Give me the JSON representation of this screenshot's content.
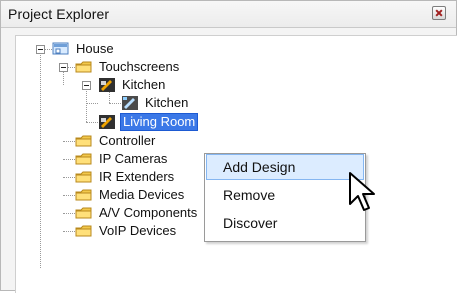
{
  "panel": {
    "title": "Project Explorer"
  },
  "tree": {
    "root": "House",
    "touchscreens": "Touchscreens",
    "kitchen_group": "Kitchen",
    "kitchen_device": "Kitchen",
    "living_room": "Living Room",
    "controller": "Controller",
    "ip_cameras": "IP Cameras",
    "ir_extenders": "IR Extenders",
    "media_devices": "Media Devices",
    "av_components": "A/V Components",
    "voip_devices": "VoIP Devices"
  },
  "context_menu": {
    "items": [
      "Add Design",
      "Remove",
      "Discover"
    ]
  },
  "colors": {
    "selection_blue": "#3b78e7",
    "menu_hover": "#dcecff",
    "folder_yellow": "#f2c84b"
  },
  "icons": {
    "close": "close-icon",
    "house": "house-icon",
    "folder": "folder-icon",
    "touchscreen": "touchscreen-icon",
    "device": "device-icon",
    "cursor": "arrow-cursor-icon"
  }
}
